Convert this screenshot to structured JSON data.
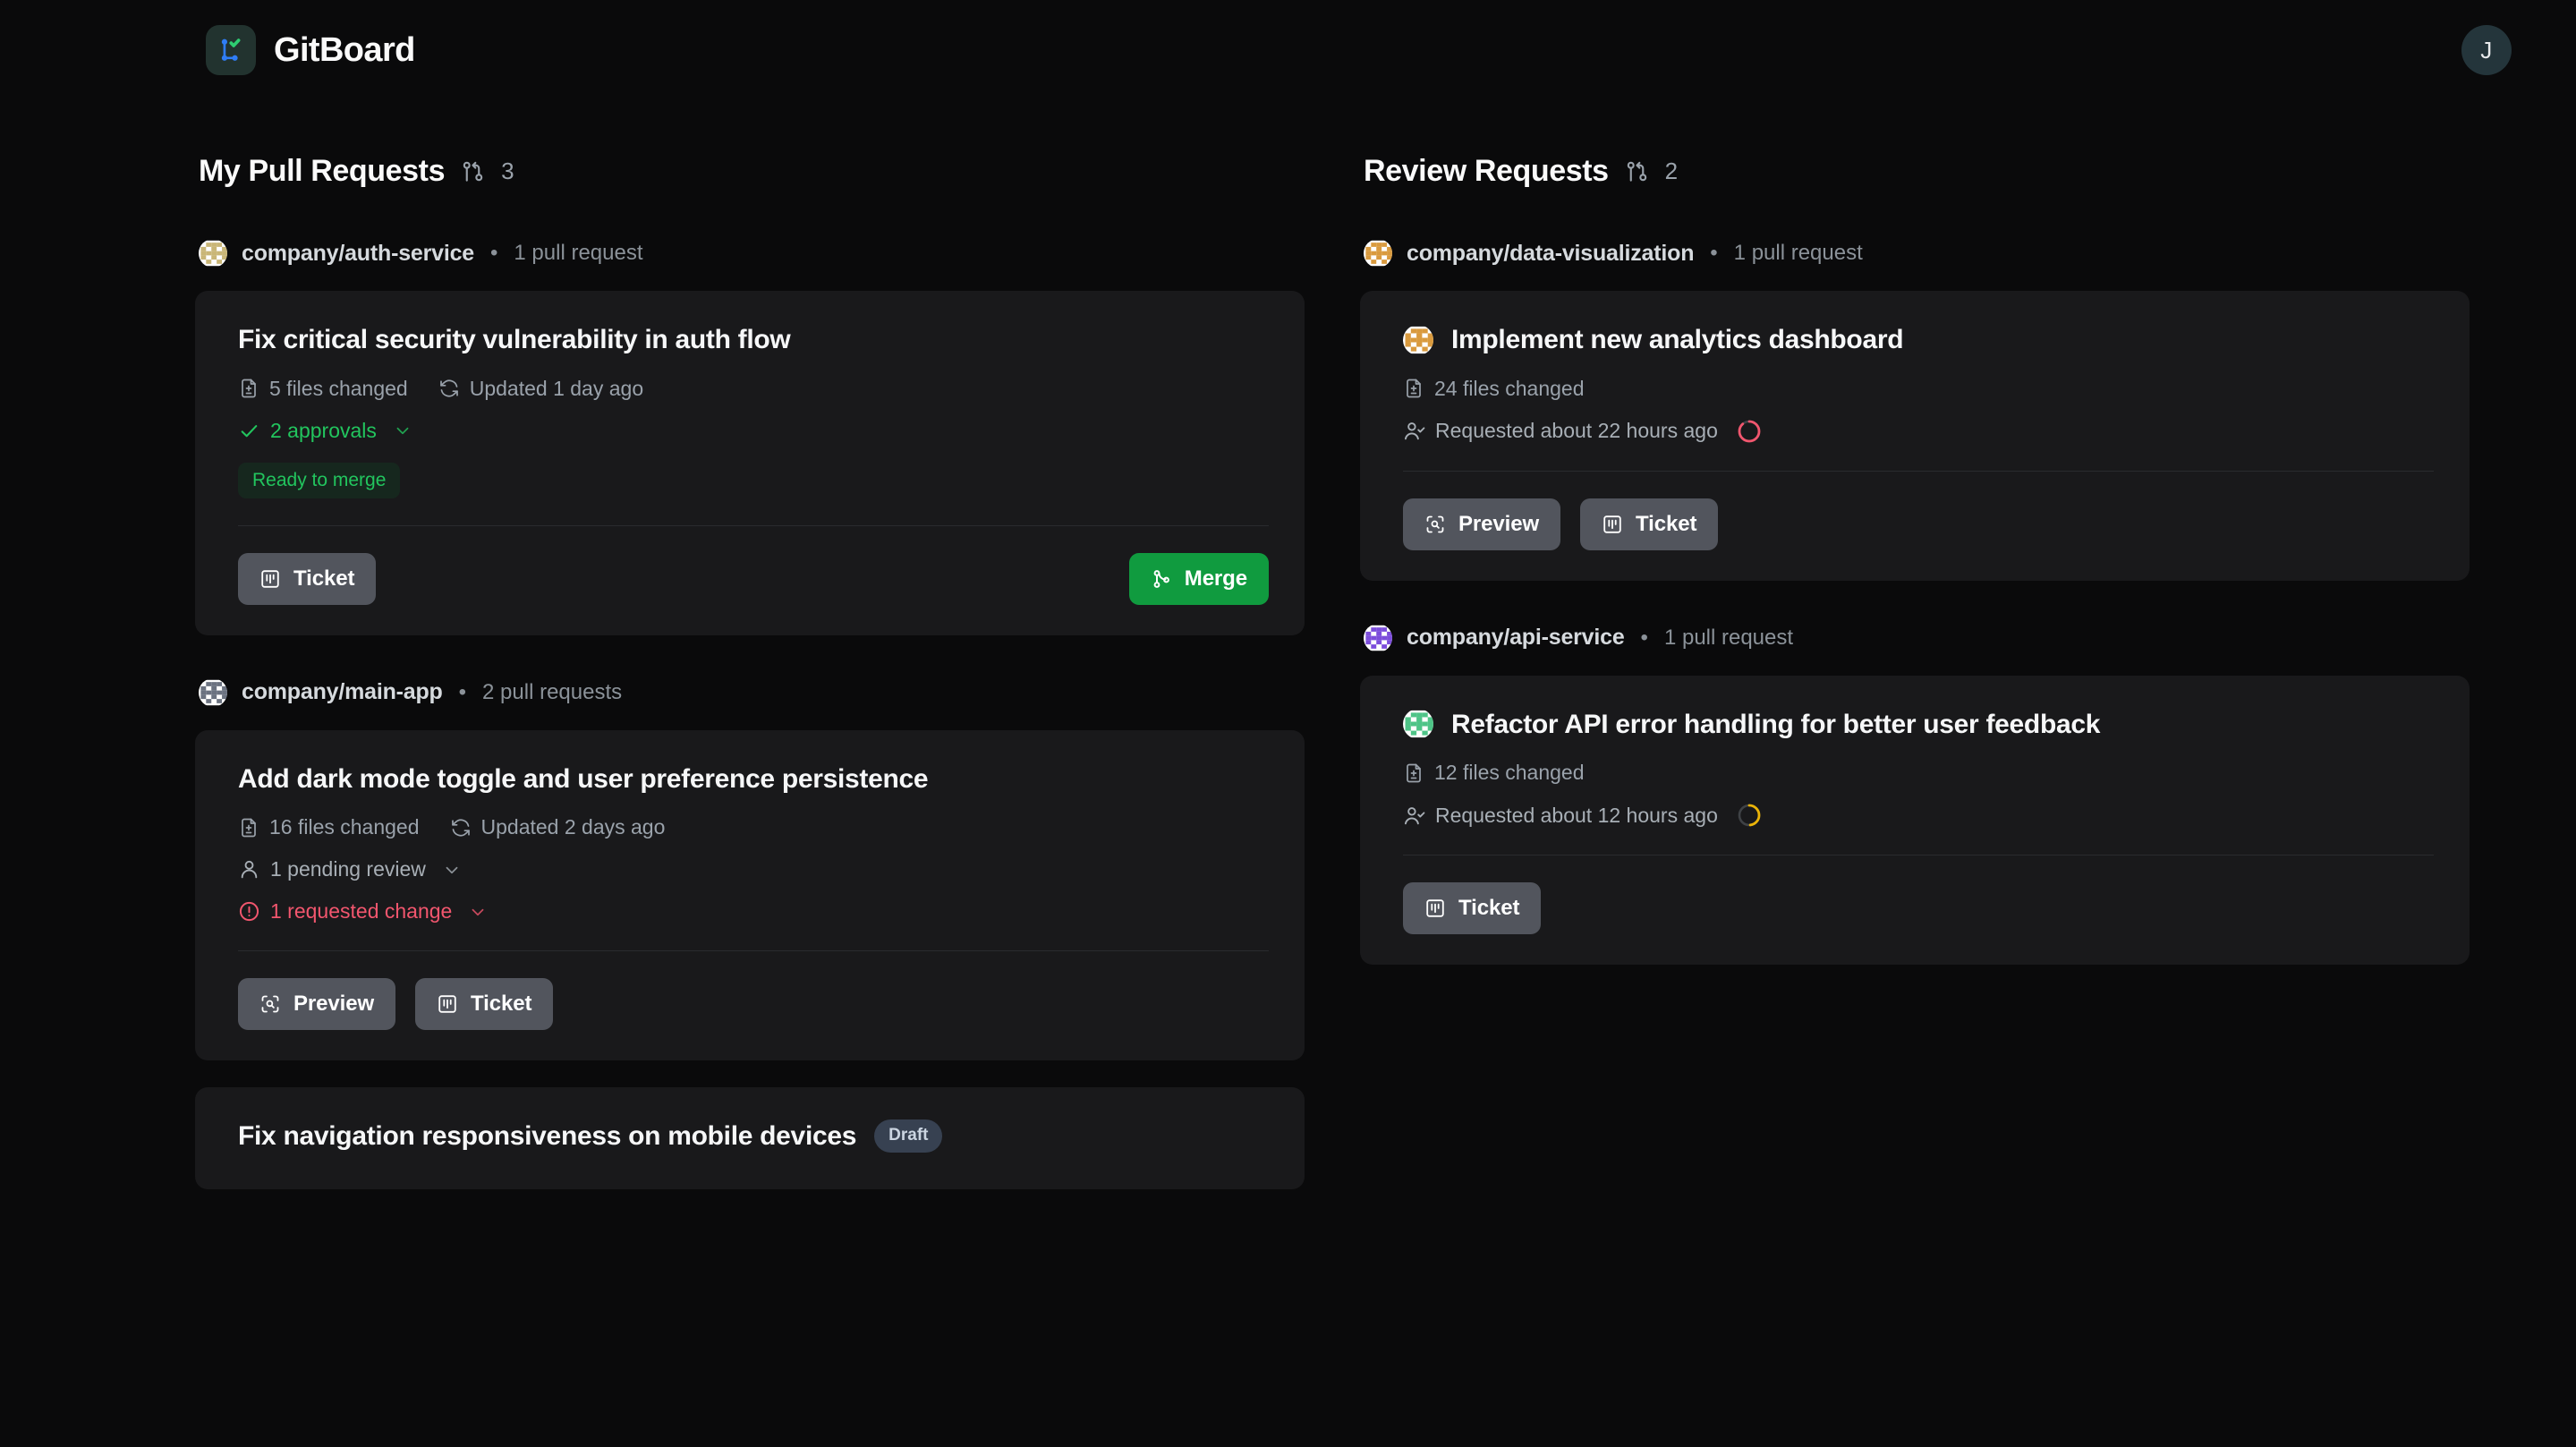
{
  "app": {
    "name": "GitBoard",
    "logo_icon": "git-branch-check-logo",
    "avatar_initial": "J"
  },
  "colors": {
    "page_bg": "#0a0a0b",
    "card_bg": "#19191b",
    "accent_green": "#22c55e",
    "merge_green": "#109b3f",
    "danger_red": "#f2566e",
    "warning_amber": "#eab308",
    "muted_text": "#9aa2ab",
    "button_grey": "#52555d"
  },
  "columns": [
    {
      "title": "My Pull Requests",
      "count": "3",
      "count_icon": "git-pull-request-icon",
      "groups": [
        {
          "repo": "company/auth-service",
          "repo_meta": "1 pull request",
          "avatar_colors": [
            "#ffffff",
            "#c9b677"
          ],
          "cards": [
            {
              "title": "Fix critical security vulnerability in auth flow",
              "badge": null,
              "avatar": null,
              "meta": [
                {
                  "icon": "file-diff-icon",
                  "text": "5 files changed"
                },
                {
                  "icon": "refresh-icon",
                  "text": "Updated 1 day ago"
                }
              ],
              "statuses": [
                {
                  "tone": "green",
                  "icon": "check-icon",
                  "text": "2 approvals",
                  "chevron": true
                }
              ],
              "ready_badge": "Ready to merge",
              "progress": null,
              "actions": [
                {
                  "label": "Ticket",
                  "icon": "kanban-icon",
                  "style": "grey",
                  "align": "left"
                },
                {
                  "label": "Merge",
                  "icon": "git-merge-icon",
                  "style": "green",
                  "align": "right"
                }
              ]
            }
          ]
        },
        {
          "repo": "company/main-app",
          "repo_meta": "2 pull requests",
          "avatar_colors": [
            "#ffffff",
            "#6b7280"
          ],
          "cards": [
            {
              "title": "Add dark mode toggle and user preference persistence",
              "badge": null,
              "avatar": null,
              "meta": [
                {
                  "icon": "file-diff-icon",
                  "text": "16 files changed"
                },
                {
                  "icon": "refresh-icon",
                  "text": "Updated 2 days ago"
                }
              ],
              "statuses": [
                {
                  "tone": "grey",
                  "icon": "user-icon",
                  "text": "1 pending review",
                  "chevron": true
                },
                {
                  "tone": "red",
                  "icon": "alert-circle-icon",
                  "text": "1 requested change",
                  "chevron": true
                }
              ],
              "ready_badge": null,
              "progress": null,
              "actions": [
                {
                  "label": "Preview",
                  "icon": "scan-search-icon",
                  "style": "grey",
                  "align": "left"
                },
                {
                  "label": "Ticket",
                  "icon": "kanban-icon",
                  "style": "grey",
                  "align": "left"
                }
              ]
            },
            {
              "title": "Fix navigation responsiveness on mobile devices",
              "badge": "Draft",
              "avatar": null,
              "meta": [],
              "statuses": [],
              "ready_badge": null,
              "progress": null,
              "actions": []
            }
          ]
        }
      ]
    },
    {
      "title": "Review Requests",
      "count": "2",
      "count_icon": "git-pull-request-icon",
      "groups": [
        {
          "repo": "company/data-visualization",
          "repo_meta": "1 pull request",
          "avatar_colors": [
            "#ffffff",
            "#d99a3e"
          ],
          "cards": [
            {
              "title": "Implement new analytics dashboard",
              "badge": null,
              "avatar": [
                "#ffffff",
                "#d99a3e"
              ],
              "meta": [
                {
                  "icon": "file-diff-icon",
                  "text": "24 files changed"
                }
              ],
              "statuses": [
                {
                  "tone": "grey",
                  "icon": "user-check-icon",
                  "text": "Requested about 22 hours ago",
                  "chevron": false
                }
              ],
              "ready_badge": null,
              "progress": {
                "color": "#f2566e",
                "percent": 88
              },
              "actions": [
                {
                  "label": "Preview",
                  "icon": "scan-search-icon",
                  "style": "grey",
                  "align": "left"
                },
                {
                  "label": "Ticket",
                  "icon": "kanban-icon",
                  "style": "grey",
                  "align": "left"
                }
              ]
            }
          ]
        },
        {
          "repo": "company/api-service",
          "repo_meta": "1 pull request",
          "avatar_colors": [
            "#ffffff",
            "#7c4ddb"
          ],
          "cards": [
            {
              "title": "Refactor API error handling for better user feedback",
              "badge": null,
              "avatar": [
                "#ffffff",
                "#4ec487"
              ],
              "meta": [
                {
                  "icon": "file-diff-icon",
                  "text": "12 files changed"
                }
              ],
              "statuses": [
                {
                  "tone": "grey",
                  "icon": "user-check-icon",
                  "text": "Requested about 12 hours ago",
                  "chevron": false
                }
              ],
              "ready_badge": null,
              "progress": {
                "color": "#eab308",
                "percent": 48
              },
              "actions": [
                {
                  "label": "Ticket",
                  "icon": "kanban-icon",
                  "style": "grey",
                  "align": "left"
                }
              ]
            }
          ]
        }
      ]
    }
  ]
}
